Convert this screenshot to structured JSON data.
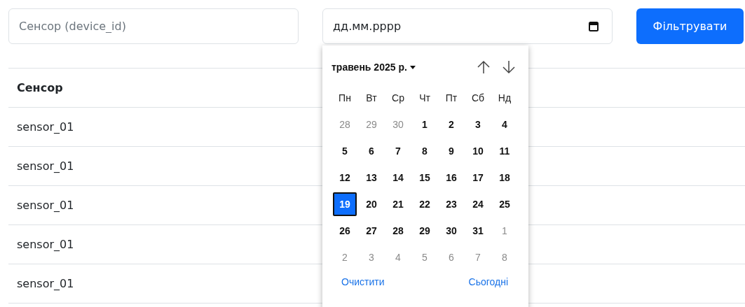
{
  "filters": {
    "sensor": {
      "placeholder": "Сенсор (device_id)"
    },
    "date": {
      "placeholder": "дд.мм.рррр"
    },
    "button": "Фільтрувати"
  },
  "table": {
    "columns": [
      "Сенсор"
    ],
    "rows": [
      [
        "sensor_01"
      ],
      [
        "sensor_01"
      ],
      [
        "sensor_01"
      ],
      [
        "sensor_01"
      ],
      [
        "sensor_01"
      ]
    ]
  },
  "datepicker": {
    "month": "травень 2025 р.",
    "weekdays": [
      "Пн",
      "Вт",
      "Ср",
      "Чт",
      "Пт",
      "Сб",
      "Нд"
    ],
    "days": [
      {
        "label": "28",
        "outside": true,
        "selected": false
      },
      {
        "label": "29",
        "outside": true,
        "selected": false
      },
      {
        "label": "30",
        "outside": true,
        "selected": false
      },
      {
        "label": "1",
        "outside": false,
        "selected": false
      },
      {
        "label": "2",
        "outside": false,
        "selected": false
      },
      {
        "label": "3",
        "outside": false,
        "selected": false
      },
      {
        "label": "4",
        "outside": false,
        "selected": false
      },
      {
        "label": "5",
        "outside": false,
        "selected": false
      },
      {
        "label": "6",
        "outside": false,
        "selected": false
      },
      {
        "label": "7",
        "outside": false,
        "selected": false
      },
      {
        "label": "8",
        "outside": false,
        "selected": false
      },
      {
        "label": "9",
        "outside": false,
        "selected": false
      },
      {
        "label": "10",
        "outside": false,
        "selected": false
      },
      {
        "label": "11",
        "outside": false,
        "selected": false
      },
      {
        "label": "12",
        "outside": false,
        "selected": false
      },
      {
        "label": "13",
        "outside": false,
        "selected": false
      },
      {
        "label": "14",
        "outside": false,
        "selected": false
      },
      {
        "label": "15",
        "outside": false,
        "selected": false
      },
      {
        "label": "16",
        "outside": false,
        "selected": false
      },
      {
        "label": "17",
        "outside": false,
        "selected": false
      },
      {
        "label": "18",
        "outside": false,
        "selected": false
      },
      {
        "label": "19",
        "outside": false,
        "selected": true
      },
      {
        "label": "20",
        "outside": false,
        "selected": false
      },
      {
        "label": "21",
        "outside": false,
        "selected": false
      },
      {
        "label": "22",
        "outside": false,
        "selected": false
      },
      {
        "label": "23",
        "outside": false,
        "selected": false
      },
      {
        "label": "24",
        "outside": false,
        "selected": false
      },
      {
        "label": "25",
        "outside": false,
        "selected": false
      },
      {
        "label": "26",
        "outside": false,
        "selected": false
      },
      {
        "label": "27",
        "outside": false,
        "selected": false
      },
      {
        "label": "28",
        "outside": false,
        "selected": false
      },
      {
        "label": "29",
        "outside": false,
        "selected": false
      },
      {
        "label": "30",
        "outside": false,
        "selected": false
      },
      {
        "label": "31",
        "outside": false,
        "selected": false
      },
      {
        "label": "1",
        "outside": true,
        "selected": false
      },
      {
        "label": "2",
        "outside": true,
        "selected": false
      },
      {
        "label": "3",
        "outside": true,
        "selected": false
      },
      {
        "label": "4",
        "outside": true,
        "selected": false
      },
      {
        "label": "5",
        "outside": true,
        "selected": false
      },
      {
        "label": "6",
        "outside": true,
        "selected": false
      },
      {
        "label": "7",
        "outside": true,
        "selected": false
      },
      {
        "label": "8",
        "outside": true,
        "selected": false
      }
    ],
    "clear": "Очистити",
    "today": "Сьогодні"
  }
}
